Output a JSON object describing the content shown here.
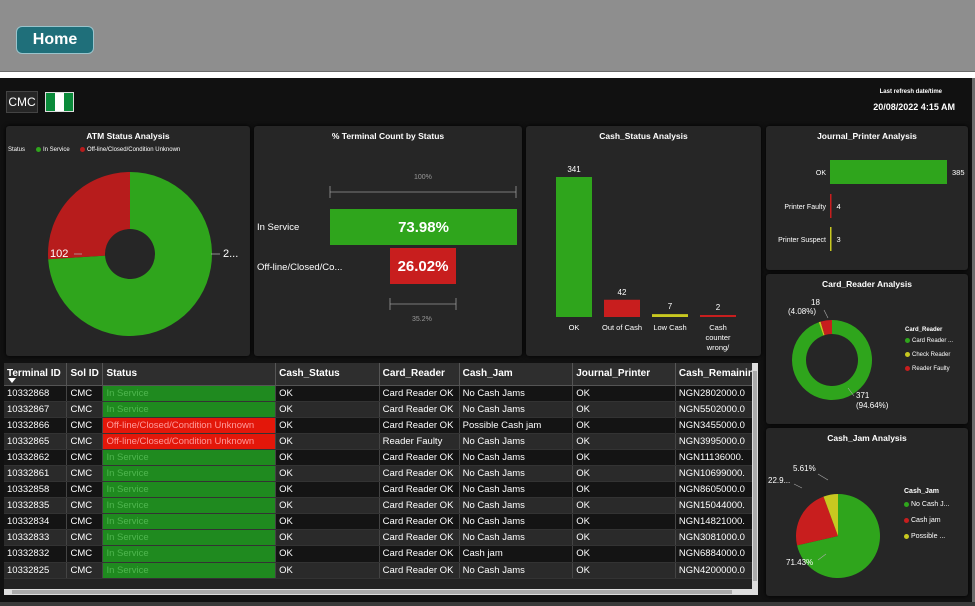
{
  "nav": {
    "home_label": "Home"
  },
  "header": {
    "cmc_label": "CMC",
    "refresh_label": "Last refresh date/time",
    "refresh_value": "20/08/2022 4:15 AM"
  },
  "atm_status": {
    "title": "ATM Status Analysis",
    "legend_label": "Status",
    "legend": [
      {
        "label": "In Service",
        "color": "#2fa51c"
      },
      {
        "label": "Off-line/Closed/Condition Unknown",
        "color": "#b71c1c"
      }
    ],
    "label_left": "102",
    "label_right": "2..."
  },
  "terminal_count": {
    "title": "% Terminal Count by Status",
    "top_label": "100%",
    "bottom_label": "35.2%",
    "rows": [
      {
        "label": "In Service",
        "value": "73.98%"
      },
      {
        "label": "Off-line/Closed/Co...",
        "value": "26.02%"
      }
    ]
  },
  "cash_status": {
    "title": "Cash_Status Analysis"
  },
  "journal_printer": {
    "title": "Journal_Printer Analysis"
  },
  "card_reader": {
    "title": "Card_Reader Analysis",
    "label_top_value": "18",
    "label_top_pct": "(4.08%)",
    "label_bottom_value": "371",
    "label_bottom_pct": "(94.64%)",
    "legend_title": "Card_Reader",
    "legend": [
      {
        "label": "Card Reader ...",
        "color": "#2fa51c"
      },
      {
        "label": "Check Reader",
        "color": "#c8c820"
      },
      {
        "label": "Reader Faulty",
        "color": "#c81e1e"
      }
    ]
  },
  "cash_jam": {
    "title": "Cash_Jam Analysis",
    "label_a": "5.61%",
    "label_b": "22.9...",
    "label_c": "71.43%",
    "legend_title": "Cash_Jam",
    "legend": [
      {
        "label": "No Cash J...",
        "color": "#2fa51c"
      },
      {
        "label": "Cash jam",
        "color": "#c81e1e"
      },
      {
        "label": "Possible ...",
        "color": "#c8c820"
      }
    ]
  },
  "chart_data": [
    {
      "type": "bar",
      "title": "Cash_Status Analysis",
      "categories": [
        "OK",
        "Out of Cash",
        "Low Cash",
        "Cash counter wrong/"
      ],
      "values": [
        341,
        42,
        7,
        2
      ],
      "colors": [
        "#2fa51c",
        "#c81e1e",
        "#c8c820",
        "#c81e1e"
      ]
    },
    {
      "type": "bar",
      "orientation": "horizontal",
      "title": "Journal_Printer Analysis",
      "categories": [
        "OK",
        "Printer Faulty",
        "Printer Suspect"
      ],
      "values": [
        385,
        4,
        3
      ],
      "colors": [
        "#2fa51c",
        "#c81e1e",
        "#c8c820"
      ]
    },
    {
      "type": "pie",
      "title": "ATM Status Analysis",
      "categories": [
        "In Service",
        "Off-line/Closed/Condition Unknown"
      ],
      "values": [
        290,
        102
      ],
      "colors": [
        "#2fa51c",
        "#b71c1c"
      ]
    },
    {
      "type": "pie",
      "title": "Card_Reader Analysis",
      "categories": [
        "Card Reader OK",
        "Check Reader",
        "Reader Faulty"
      ],
      "values": [
        371,
        3,
        18
      ],
      "colors": [
        "#2fa51c",
        "#c8c820",
        "#c81e1e"
      ]
    },
    {
      "type": "pie",
      "title": "Cash_Jam Analysis",
      "categories": [
        "No Cash Jams",
        "Cash jam",
        "Possible Cash jam"
      ],
      "values": [
        71.43,
        22.96,
        5.61
      ],
      "colors": [
        "#2fa51c",
        "#c81e1e",
        "#c8c820"
      ]
    }
  ],
  "table": {
    "columns": [
      "Terminal ID",
      "Sol ID",
      "Status",
      "Cash_Status",
      "Card_Reader",
      "Cash_Jam",
      "Journal_Printer",
      "Cash_Remainin"
    ],
    "rows": [
      [
        "10332868",
        "CMC",
        "In Service",
        "OK",
        "Card Reader OK",
        "No Cash Jams",
        "OK",
        "NGN2802000.0"
      ],
      [
        "10332867",
        "CMC",
        "In Service",
        "OK",
        "Card Reader OK",
        "No Cash Jams",
        "OK",
        "NGN5502000.0"
      ],
      [
        "10332866",
        "CMC",
        "Off-line/Closed/Condition Unknown",
        "OK",
        "Card Reader OK",
        "Possible Cash jam",
        "OK",
        "NGN3455000.0"
      ],
      [
        "10332865",
        "CMC",
        "Off-line/Closed/Condition Unknown",
        "OK",
        "Reader Faulty",
        "No Cash Jams",
        "OK",
        "NGN3995000.0"
      ],
      [
        "10332862",
        "CMC",
        "In Service",
        "OK",
        "Card Reader OK",
        "No Cash Jams",
        "OK",
        "NGN11136000."
      ],
      [
        "10332861",
        "CMC",
        "In Service",
        "OK",
        "Card Reader OK",
        "No Cash Jams",
        "OK",
        "NGN10699000."
      ],
      [
        "10332858",
        "CMC",
        "In Service",
        "OK",
        "Card Reader OK",
        "No Cash Jams",
        "OK",
        "NGN8605000.0"
      ],
      [
        "10332835",
        "CMC",
        "In Service",
        "OK",
        "Card Reader OK",
        "No Cash Jams",
        "OK",
        "NGN15044000."
      ],
      [
        "10332834",
        "CMC",
        "In Service",
        "OK",
        "Card Reader OK",
        "No Cash Jams",
        "OK",
        "NGN14821000."
      ],
      [
        "10332833",
        "CMC",
        "In Service",
        "OK",
        "Card Reader OK",
        "No Cash Jams",
        "OK",
        "NGN3081000.0"
      ],
      [
        "10332832",
        "CMC",
        "In Service",
        "OK",
        "Card Reader OK",
        "Cash jam",
        "OK",
        "NGN6884000.0"
      ],
      [
        "10332825",
        "CMC",
        "In Service",
        "OK",
        "Card Reader OK",
        "No Cash Jams",
        "OK",
        "NGN4200000.0"
      ]
    ]
  }
}
